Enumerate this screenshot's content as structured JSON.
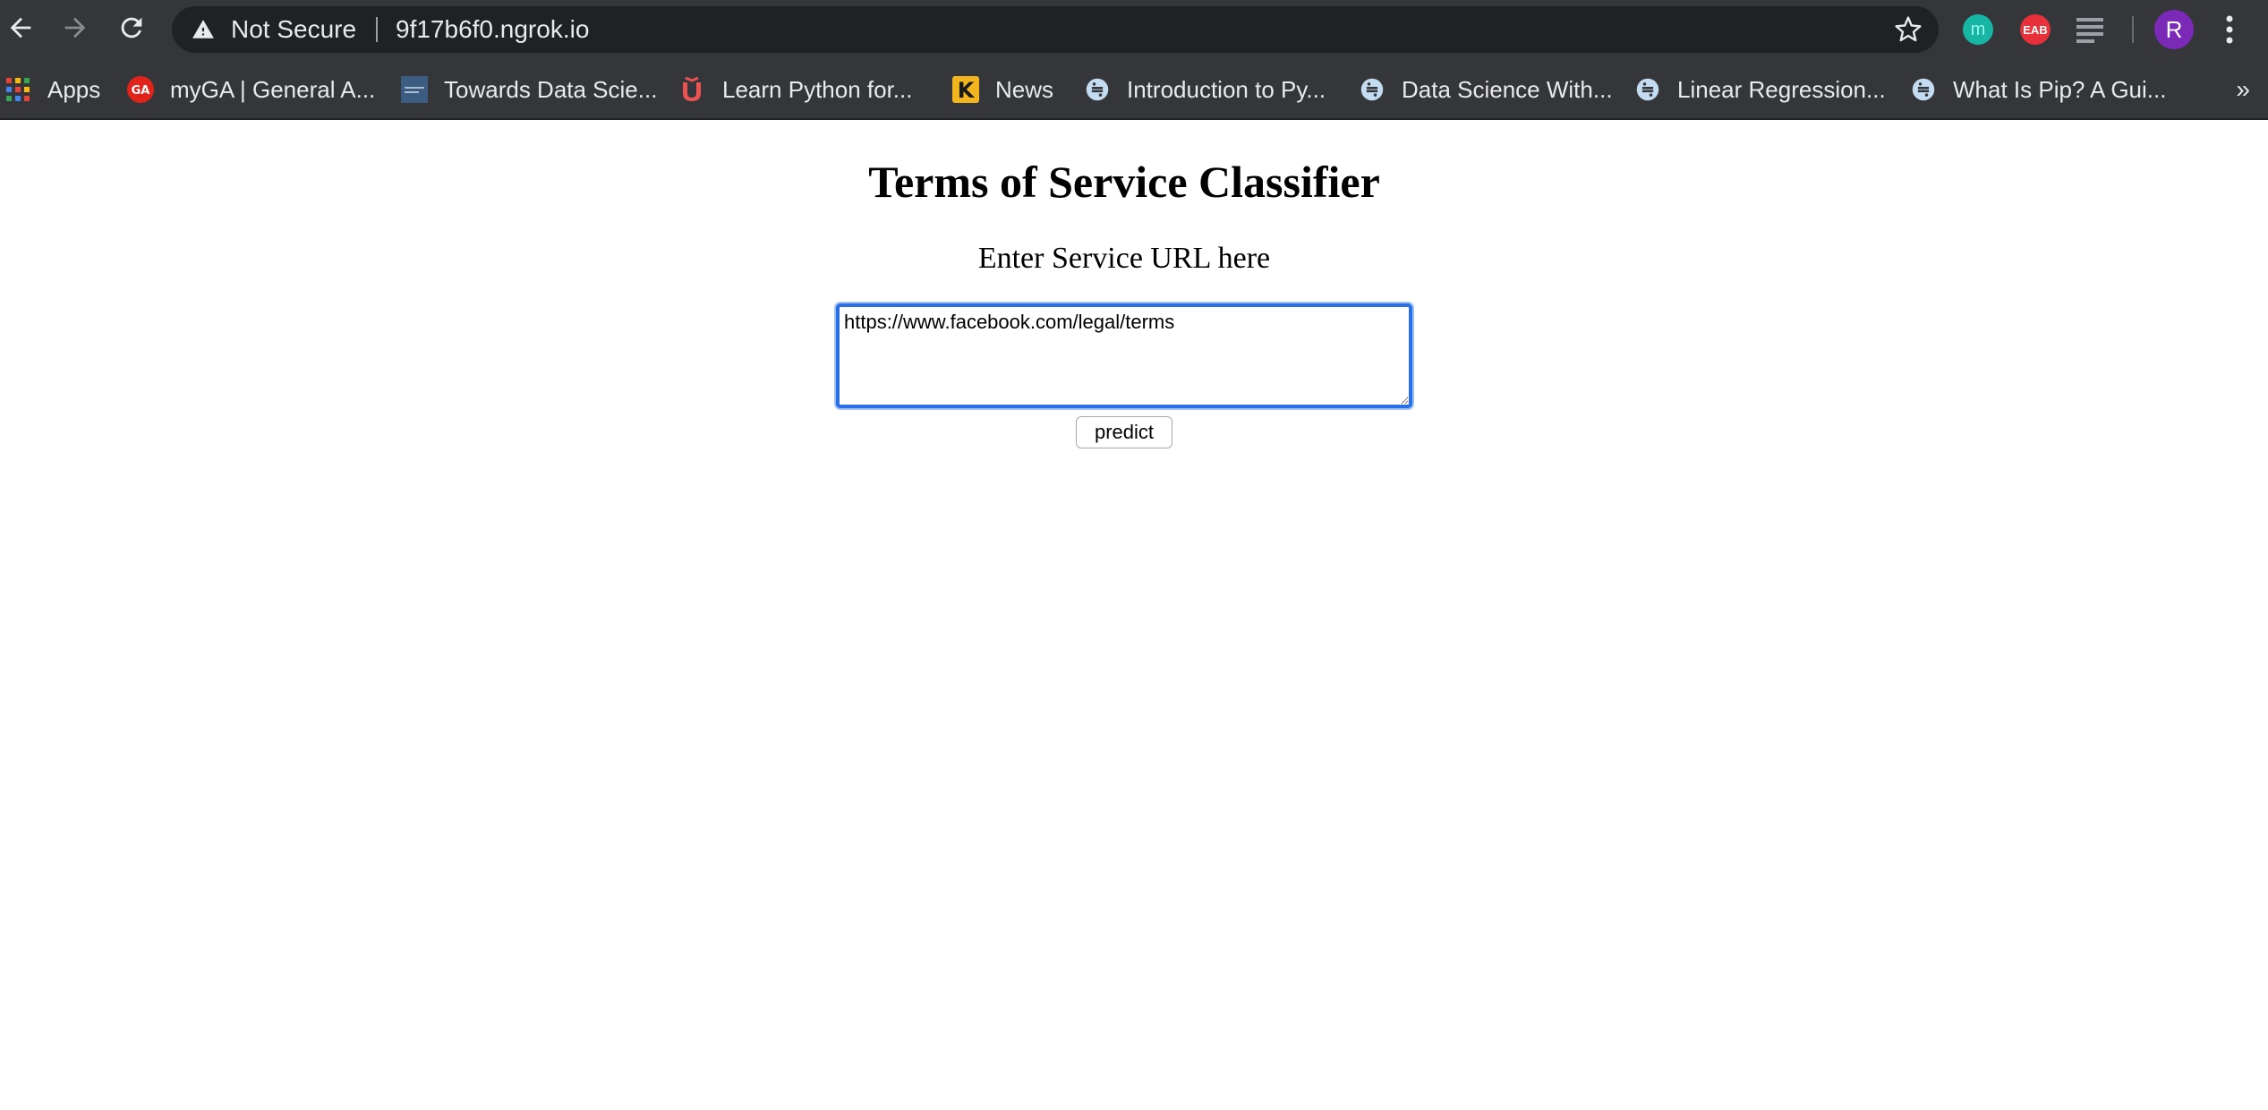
{
  "browser": {
    "security_label": "Not Secure",
    "url": "9f17b6f0.ngrok.io",
    "icons": {
      "back": "back-arrow-icon",
      "forward": "forward-arrow-icon",
      "reload": "reload-icon",
      "warning": "warning-icon",
      "bookmark_star": "star-icon",
      "menu": "kebab-menu-icon"
    },
    "extensions": [
      {
        "name": "m-extension-icon",
        "label": "m"
      },
      {
        "name": "eab-extension-icon",
        "label": "EAB"
      },
      {
        "name": "reader-extension-icon",
        "label": ""
      }
    ],
    "profile_initial": "R",
    "colors": {
      "chrome_bg": "#35363a",
      "omnibox_bg": "#202124",
      "text": "#e8eaed",
      "profile": "#7b2ab8",
      "focus_ring": "#2a6fe5"
    }
  },
  "bookmarks": {
    "items": [
      {
        "label": "Apps",
        "icon": "apps-grid-icon"
      },
      {
        "label": "myGA | General A...",
        "icon": "ga-logo-icon"
      },
      {
        "label": "Towards Data Scie...",
        "icon": "tds-logo-icon"
      },
      {
        "label": "Learn Python for...",
        "icon": "udemy-logo-icon"
      },
      {
        "label": "News",
        "icon": "k-logo-icon"
      },
      {
        "label": "Introduction to Py...",
        "icon": "python-logo-icon"
      },
      {
        "label": "Data Science With...",
        "icon": "python-logo-icon"
      },
      {
        "label": "Linear Regression...",
        "icon": "python-logo-icon"
      },
      {
        "label": "What Is Pip? A Gui...",
        "icon": "python-logo-icon"
      }
    ],
    "more": "»"
  },
  "page": {
    "title": "Terms of Service Classifier",
    "prompt": "Enter Service URL here",
    "input_value": "https://www.facebook.com/legal/terms",
    "submit_label": "predict"
  }
}
